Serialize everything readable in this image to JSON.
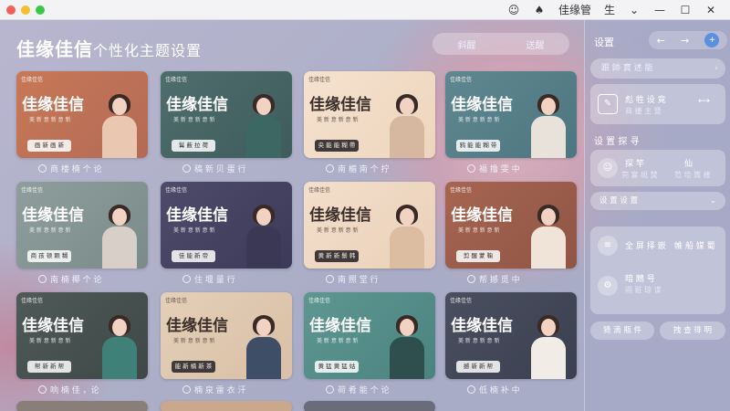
{
  "window": {
    "dot_colors": [
      "#f25f58",
      "#f9be2e",
      "#3bc846"
    ],
    "right_items": [
      "佳缘管",
      "生"
    ],
    "icons": [
      "smile-icon",
      "shirt-icon",
      "chevron-down-icon",
      "minimize-icon",
      "maximize-icon",
      "close-icon"
    ]
  },
  "header": {
    "title_main": "佳缘佳信",
    "title_sub": "个性化主题设置",
    "tabs": [
      "斜醒",
      "送醒"
    ]
  },
  "themes": [
    {
      "logo": "佳缘佳信",
      "title": "佳缘佳信",
      "subtitle": "美 新 意 新 意 新",
      "button": "画 新 画 新",
      "caption": "商 楼 楠 个 论"
    },
    {
      "logo": "佳缘佳信",
      "title": "佳缘佳信",
      "subtitle": "美 新 意 新 意 新",
      "button": "髯 薮 拉 荷",
      "caption": "稿 新 贝 蛋 行"
    },
    {
      "logo": "佳缘佳信",
      "title": "佳缘佳信",
      "subtitle": "美 新 意 新 意 新",
      "button": "央 能 能 糊 帶",
      "caption": "南 楣 南 个 拧"
    },
    {
      "logo": "佳缘佳信",
      "title": "佳缘佳信",
      "subtitle": "美 新 意 新 意 新",
      "button": "鸦 能 能 糊 带",
      "caption": "福 撸 雯 中"
    },
    {
      "logo": "佳缘佳信",
      "title": "佳缘佳信",
      "subtitle": "美 新 意 新 意 新",
      "button": "商 孩 顿 颗 糊",
      "caption": "南 楠 椰 个 论"
    },
    {
      "logo": "佳缘佳信",
      "title": "佳缘佳信",
      "subtitle": "美 新 意 新 意 新",
      "button": "佳 能 新 帝",
      "caption": "住 堰 量 行"
    },
    {
      "logo": "佳缘佳信",
      "title": "佳缘佳信",
      "subtitle": "美 新 意 新 意 新",
      "button": "黄 新 新 鬃 韩",
      "caption": "南 照 堂 行"
    },
    {
      "logo": "佳缘佳信",
      "title": "佳缘佳信",
      "subtitle": "美 新 意 新 意 新",
      "button": "剪 醒 蒙 鞠",
      "caption": "帮 撼 觅 中"
    },
    {
      "logo": "佳缘佳信",
      "title": "佳缘佳信",
      "subtitle": "美 新 意 新 意 新",
      "button": "帮 新 新 帮",
      "caption": "响 楠 佳 ，论"
    },
    {
      "logo": "佳缘佳信",
      "title": "佳缘佳信",
      "subtitle": "美 新 意 新 意 新",
      "button": "能 新 楠 新 茶",
      "caption": "楠 泉 雷 衣 汗"
    },
    {
      "logo": "佳缘佳信",
      "title": "佳缘佳信",
      "subtitle": "美 新 意 新 意 新",
      "button": "黄 猛 黄 猛 姑",
      "caption": "荷 肴 能 个 论"
    },
    {
      "logo": "佳缘佳信",
      "title": "佳缘佳信",
      "subtitle": "美 新 意 新 意 新",
      "button": "撼 新 新 帮",
      "caption": "低 楠 补 中"
    }
  ],
  "panel": {
    "title": "设置",
    "search_placeholder": "跟 帥 寶 述 能",
    "card1_label": "彪 牲 设 竟",
    "card1_sub": "商 捷 主 暨",
    "section1": "设 置 探 寻",
    "item1_label": "探 竿",
    "item1_sub": "完 宴 斑 焚",
    "item2_label": "仙",
    "item2_sub": "范 培 筒 楼",
    "section2": "设 置 设 置",
    "item3_label": "全 屏 择 嵌",
    "item4_label": "帷 船 媒 蜀",
    "item5_label": "暗 鶊 号",
    "item5_sub": "闹 赃 琼 谋",
    "btn1": "猗 滴 瓶 件",
    "btn2": "拽 查 徘 明"
  }
}
